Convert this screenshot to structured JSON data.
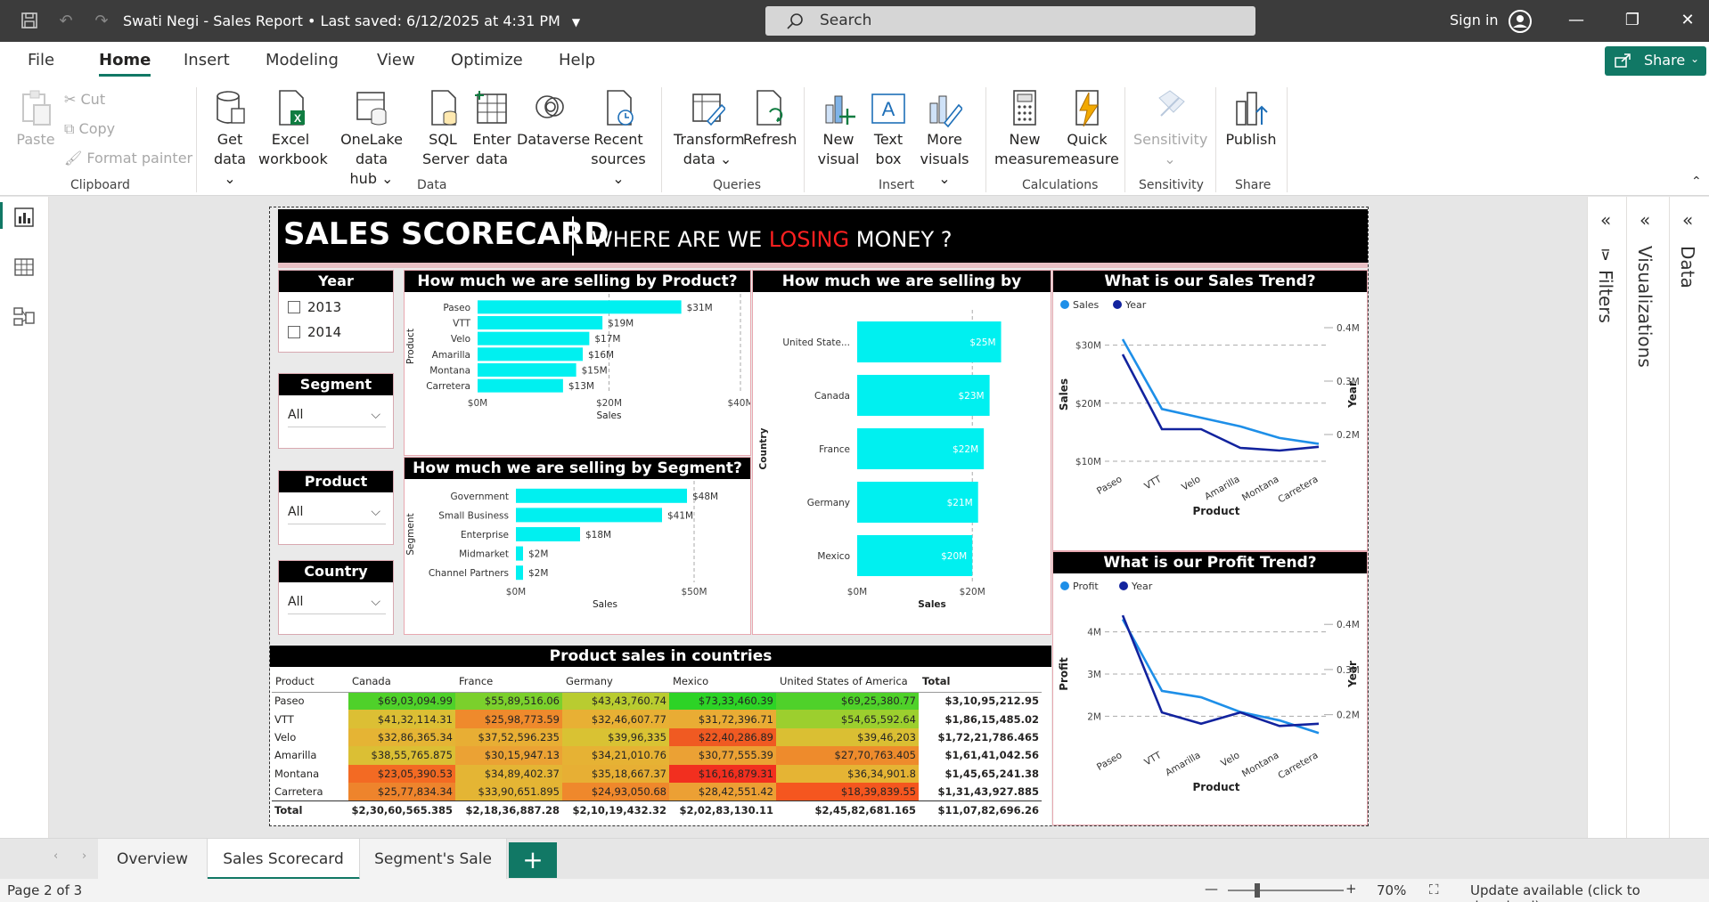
{
  "titlebar": {
    "document_title": "Swati Negi - Sales Report",
    "saved_status": "Last saved: 6/12/2025 at 4:31 PM",
    "search_placeholder": "Search",
    "signin_label": "Sign in"
  },
  "menu": {
    "tabs": [
      "File",
      "Home",
      "Insert",
      "Modeling",
      "View",
      "Optimize",
      "Help"
    ],
    "active_tab": "Home",
    "share_label": "Share"
  },
  "ribbon": {
    "clipboard": {
      "paste": "Paste",
      "cut": "Cut",
      "copy": "Copy",
      "format_painter": "Format painter",
      "label": "Clipboard"
    },
    "data": {
      "get_data": [
        "Get",
        "data"
      ],
      "excel": [
        "Excel",
        "workbook"
      ],
      "onelake": [
        "OneLake data",
        "hub"
      ],
      "sql": [
        "SQL",
        "Server"
      ],
      "enter_data": [
        "Enter",
        "data"
      ],
      "dataverse": "Dataverse",
      "recent": [
        "Recent",
        "sources"
      ],
      "label": "Data"
    },
    "queries": {
      "transform": [
        "Transform",
        "data"
      ],
      "refresh": "Refresh",
      "label": "Queries"
    },
    "insert": {
      "new_visual": [
        "New",
        "visual"
      ],
      "text_box": [
        "Text",
        "box"
      ],
      "more_visuals": [
        "More",
        "visuals"
      ],
      "label": "Insert"
    },
    "calculations": {
      "new_measure": [
        "New",
        "measure"
      ],
      "quick_measure": [
        "Quick",
        "measure"
      ],
      "label": "Calculations"
    },
    "sensitivity": {
      "button": "Sensitivity",
      "label": "Sensitivity"
    },
    "share": {
      "publish": "Publish",
      "label": "Share"
    }
  },
  "panes": {
    "filters": "Filters",
    "visualizations": "Visualizations",
    "data": "Data"
  },
  "report": {
    "title": "SALES SCORECARD",
    "subtitle_pre": "WHERE ARE WE ",
    "subtitle_red": "LOSING",
    "subtitle_post": " MONEY ?",
    "slicers": {
      "year": {
        "title": "Year",
        "options": [
          "2013",
          "2014"
        ]
      },
      "segment": {
        "title": "Segment",
        "value": "All"
      },
      "product": {
        "title": "Product",
        "value": "All"
      },
      "country": {
        "title": "Country",
        "value": "All"
      }
    },
    "matrix": {
      "title": "Product sales in countries",
      "columns": [
        "Product",
        "Canada",
        "France",
        "Germany",
        "Mexico",
        "United States of America",
        "Total"
      ],
      "rows": [
        {
          "product": "Paseo",
          "values": [
            "$69,03,094.99",
            "$55,89,516.06",
            "$43,43,760.74",
            "$73,33,460.39",
            "$69,25,380.77"
          ],
          "total": "$3,10,95,212.95"
        },
        {
          "product": "VTT",
          "values": [
            "$41,32,114.31",
            "$25,98,773.59",
            "$32,46,607.77",
            "$31,72,396.71",
            "$54,65,592.64"
          ],
          "total": "$1,86,15,485.02"
        },
        {
          "product": "Velo",
          "values": [
            "$32,86,365.34",
            "$37,52,596.235",
            "$39,96,335",
            "$22,40,286.89",
            "$39,46,203"
          ],
          "total": "$1,72,21,786.465"
        },
        {
          "product": "Amarilla",
          "values": [
            "$38,55,765.875",
            "$30,15,947.13",
            "$34,21,010.76",
            "$30,77,555.39",
            "$27,70,763.405"
          ],
          "total": "$1,61,41,042.56"
        },
        {
          "product": "Montana",
          "values": [
            "$23,05,390.53",
            "$34,89,402.37",
            "$35,18,667.37",
            "$16,16,879.31",
            "$36,34,901.8"
          ],
          "total": "$1,45,65,241.38"
        },
        {
          "product": "Carretera",
          "values": [
            "$25,77,834.34",
            "$33,90,651.895",
            "$24,93,050.68",
            "$28,42,551.42",
            "$18,39,839.55"
          ],
          "total": "$1,31,43,927.885"
        }
      ],
      "cell_colors": [
        [
          "#4fd12a",
          "#7bd02c",
          "#b9cc30",
          "#2dd326",
          "#4fd12a"
        ],
        [
          "#dcbf34",
          "#ef8a2c",
          "#e8b034",
          "#e9ac34",
          "#9ccf2e"
        ],
        [
          "#e5b434",
          "#e8ae34",
          "#d9c233",
          "#f05a22",
          "#dabf33"
        ],
        [
          "#dbbf34",
          "#eba234",
          "#e6b234",
          "#eba134",
          "#ee8b2c"
        ],
        [
          "#f36a23",
          "#e4b534",
          "#e7af34",
          "#f22f1f",
          "#e5b434"
        ],
        [
          "#ee842c",
          "#e4b534",
          "#ef882c",
          "#eca034",
          "#f5561f"
        ]
      ],
      "total_row": {
        "label": "Total",
        "values": [
          "$2,30,60,565.385",
          "$2,18,36,887.28",
          "$2,10,19,432.32",
          "$2,02,83,130.11",
          "$2,45,82,681.165"
        ],
        "total": "$11,07,82,696.26"
      }
    }
  },
  "chart_data": [
    {
      "type": "bar",
      "title": "How much we are selling by Product?",
      "categories": [
        "Paseo",
        "VTT",
        "Velo",
        "Amarilla",
        "Montana",
        "Carretera"
      ],
      "values": [
        31,
        19,
        17,
        16,
        15,
        13
      ],
      "labels": [
        "$31M",
        "$19M",
        "$17M",
        "$16M",
        "$15M",
        "$13M"
      ],
      "xlabel": "Sales",
      "ylabel": "Product",
      "xticks": [
        "$0M",
        "$20M",
        "$40M"
      ],
      "xlim": [
        0,
        40
      ],
      "color": "#00f0f0"
    },
    {
      "type": "bar",
      "title": "How much we are selling by Segment?",
      "categories": [
        "Government",
        "Small Business",
        "Enterprise",
        "Midmarket",
        "Channel Partners"
      ],
      "values": [
        48,
        41,
        18,
        2,
        2
      ],
      "labels": [
        "$48M",
        "$41M",
        "$18M",
        "$2M",
        "$2M"
      ],
      "xlabel": "Sales",
      "ylabel": "Segment",
      "xticks": [
        "$0M",
        "$50M"
      ],
      "xlim": [
        0,
        50
      ],
      "color": "#00f0f0"
    },
    {
      "type": "bar",
      "title": "How much we are selling by Country?",
      "categories": [
        "United State...",
        "Canada",
        "France",
        "Germany",
        "Mexico"
      ],
      "values": [
        25,
        23,
        22,
        21,
        20
      ],
      "labels": [
        "$25M",
        "$23M",
        "$22M",
        "$21M",
        "$20M"
      ],
      "xlabel": "Sales",
      "ylabel": "Country",
      "xticks": [
        "$0M",
        "$20M"
      ],
      "xlim": [
        0,
        26
      ],
      "color": "#00f0f0"
    },
    {
      "type": "line",
      "title": "What is our Sales Trend?",
      "x": [
        "Paseo",
        "VTT",
        "Velo",
        "Amarilla",
        "Montana",
        "Carretera"
      ],
      "series": [
        {
          "name": "Sales",
          "axis": "left",
          "values": [
            31,
            19,
            17.5,
            16,
            14,
            13
          ],
          "color": "#1e8fe8"
        },
        {
          "name": "Year",
          "axis": "right",
          "values": [
            0.35,
            0.21,
            0.21,
            0.175,
            0.17,
            0.177
          ],
          "color": "#12239e"
        }
      ],
      "xlabel": "Product",
      "ylabel": "Sales",
      "y2label": "Year",
      "yticks": [
        "$10M",
        "$20M",
        "$30M"
      ],
      "ylim": [
        10,
        33
      ],
      "y2ticks": [
        "0.2M",
        "0.3M",
        "0.4M"
      ],
      "y2lim": [
        0.15,
        0.4
      ],
      "legend": "top-left"
    },
    {
      "type": "line",
      "title": "What is our Profit Trend?",
      "x": [
        "Paseo",
        "VTT",
        "Amarilla",
        "Velo",
        "Montana",
        "Carretera"
      ],
      "series": [
        {
          "name": "Profit",
          "axis": "left",
          "values": [
            4.3,
            2.6,
            2.45,
            2.1,
            1.9,
            1.6
          ],
          "color": "#1e8fe8"
        },
        {
          "name": "Year",
          "axis": "right",
          "values": [
            0.42,
            0.205,
            0.18,
            0.205,
            0.175,
            0.18
          ],
          "color": "#12239e"
        }
      ],
      "xlabel": "Product",
      "ylabel": "Profit",
      "y2label": "Year",
      "yticks": [
        "2M",
        "3M",
        "4M"
      ],
      "ylim": [
        1.5,
        4.5
      ],
      "y2ticks": [
        "0.2M",
        "0.3M",
        "0.4M"
      ],
      "y2lim": [
        0.15,
        0.43
      ],
      "legend": "top-left"
    }
  ],
  "page_tabs": [
    "Overview",
    "Sales Scorecard",
    "Segment's Sale"
  ],
  "active_page": "Sales Scorecard",
  "status": {
    "page_info": "Page 2 of 3",
    "zoom": "70%",
    "update": "Update available (click to download)"
  }
}
